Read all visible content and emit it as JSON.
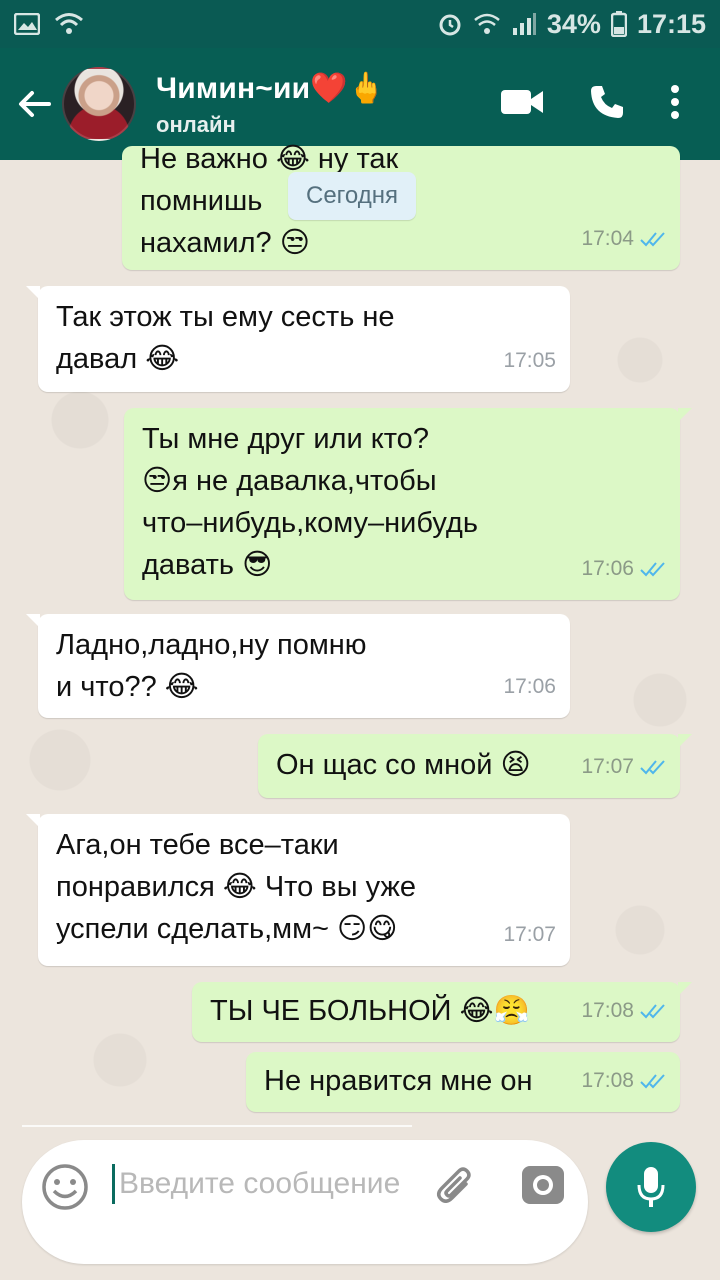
{
  "status_bar": {
    "battery": "34%",
    "time": "17:15"
  },
  "header": {
    "name": "Чимин~ии❤️🖕",
    "status": "онлайн"
  },
  "date_chip": "Сегодня",
  "messages": [
    {
      "dir": "out",
      "lines": [
        "Не важно 😂 ну так",
        "помнишь",
        "нахамил? 😒"
      ],
      "time": "17:04"
    },
    {
      "dir": "in",
      "lines": [
        "Так этож ты ему сесть не",
        "давал 😂"
      ],
      "time": "17:05"
    },
    {
      "dir": "out",
      "lines": [
        "Ты мне друг или кто?",
        "😒я не давалка,чтобы",
        "что–нибудь,кому–нибудь",
        "давать 😎"
      ],
      "time": "17:06"
    },
    {
      "dir": "in",
      "lines": [
        "Ладно,ладно,ну помню",
        "и что?? 😂"
      ],
      "time": "17:06"
    },
    {
      "dir": "out",
      "lines": [
        "Он щас со мной 😫"
      ],
      "time": "17:07"
    },
    {
      "dir": "in",
      "lines": [
        "Ага,он тебе все–таки",
        "понравился 😂 Что вы уже",
        "успели сделать,мм~ 😏😋"
      ],
      "time": "17:07"
    },
    {
      "dir": "out",
      "lines": [
        "ТЫ ЧЕ БОЛЬНОЙ 😂😤"
      ],
      "time": "17:08"
    },
    {
      "dir": "out",
      "lines": [
        "Не нравится мне он"
      ],
      "time": "17:08"
    }
  ],
  "input": {
    "placeholder": "Введите сообщение"
  },
  "colors": {
    "header": "#075e54",
    "outgoing": "#dcf8c6",
    "incoming": "#ffffff",
    "accent": "#128c7e"
  }
}
